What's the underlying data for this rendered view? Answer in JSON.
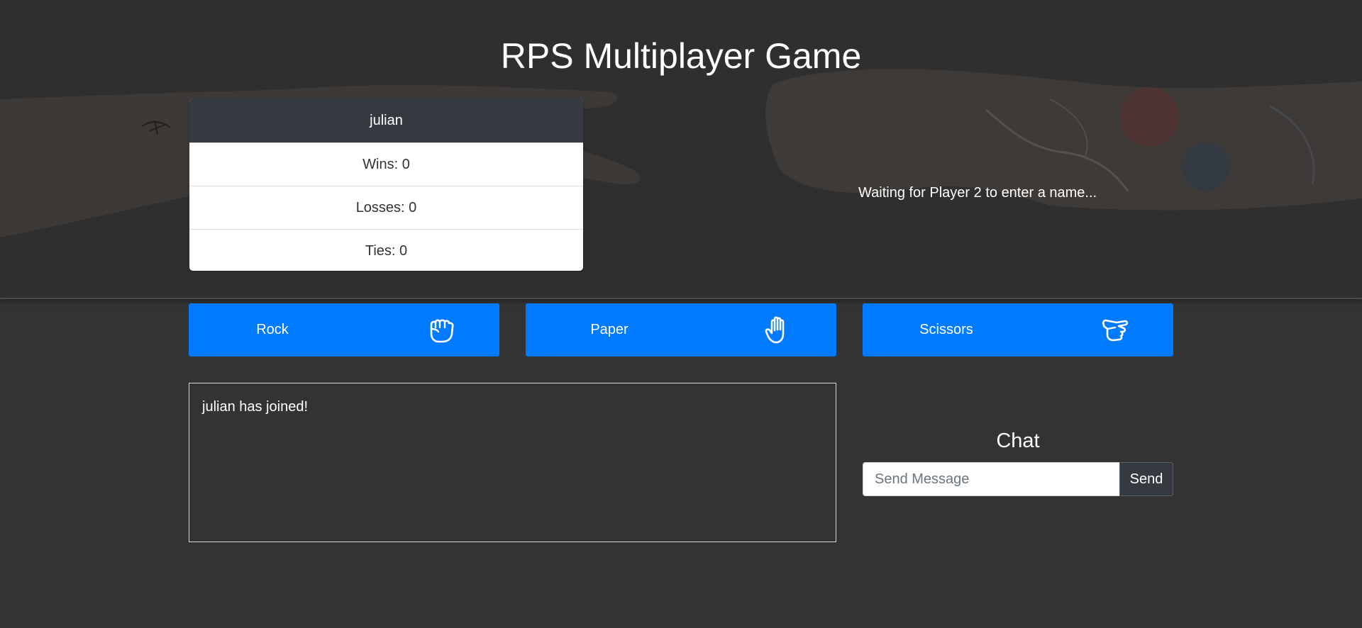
{
  "page": {
    "title": "RPS Multiplayer Game"
  },
  "player1": {
    "name": "julian",
    "wins": "Wins: 0",
    "losses": "Losses: 0",
    "ties": "Ties: 0"
  },
  "player2": {
    "status": "Waiting for Player 2 to enter a name..."
  },
  "choices": [
    {
      "label": "Rock",
      "icon": "hand-rock-icon"
    },
    {
      "label": "Paper",
      "icon": "hand-paper-icon"
    },
    {
      "label": "Scissors",
      "icon": "hand-scissors-icon"
    }
  ],
  "log": {
    "messages": [
      "julian has joined!"
    ]
  },
  "chat": {
    "title": "Chat",
    "input_placeholder": "Send Message",
    "input_value": "",
    "send_label": "Send"
  },
  "colors": {
    "background": "#333333",
    "accent": "#007bff",
    "card_header": "#343a40"
  }
}
